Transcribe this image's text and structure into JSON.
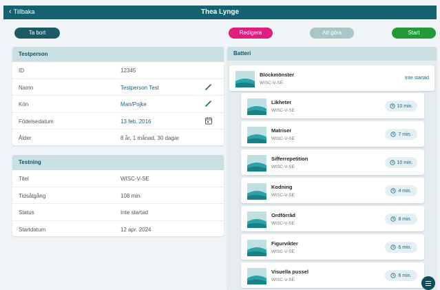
{
  "header": {
    "back_label": "Tillbaka",
    "title": "Thea Lynge"
  },
  "actions": {
    "delete": "Ta bort",
    "edit": "Redigera",
    "todo": "Att göra",
    "start": "Start"
  },
  "testperson": {
    "heading": "Testperson",
    "rows": [
      {
        "label": "ID",
        "value": "12345"
      },
      {
        "label": "Namn",
        "value": "Testperson Test"
      },
      {
        "label": "Kön",
        "value": "Man/Pojke"
      },
      {
        "label": "Födelsedatum",
        "value": "13 feb. 2016"
      },
      {
        "label": "Ålder",
        "value": "8 år, 1 månad, 30 dagar"
      }
    ]
  },
  "testning": {
    "heading": "Testning",
    "rows": [
      {
        "label": "Titel",
        "value": "WISC-V-SE"
      },
      {
        "label": "Tidsåtgång",
        "value": "108 min."
      },
      {
        "label": "Status",
        "value": "Inte startad"
      },
      {
        "label": "Startdatum",
        "value": "12 apr. 2024"
      }
    ]
  },
  "battery": {
    "heading": "Batteri",
    "main": {
      "name": "Blockmönster",
      "sub": "WISC-V-SE",
      "status": "Inte startad"
    },
    "items": [
      {
        "name": "Likheter",
        "sub": "WISC-V-SE",
        "duration": "10 min."
      },
      {
        "name": "Matriser",
        "sub": "WISC-V-SE",
        "duration": "7 min."
      },
      {
        "name": "Sifferrepetition",
        "sub": "WISC-V-SE",
        "duration": "10 min."
      },
      {
        "name": "Kodning",
        "sub": "WISC-V-SE",
        "duration": "4 min."
      },
      {
        "name": "Ordförråd",
        "sub": "WISC-V-SE",
        "duration": "8 min."
      },
      {
        "name": "Figurvikter",
        "sub": "WISC-V-SE",
        "duration": "6 min."
      },
      {
        "name": "Visuella pussel",
        "sub": "WISC-V-SE",
        "duration": "6 min."
      }
    ]
  },
  "icons": {
    "back": "chevron-left-icon",
    "edit": "pencil-icon",
    "calendar": "calendar-icon",
    "clock": "clock-icon",
    "menu": "menu-icon",
    "thumbnail": "test-thumbnail-icon"
  },
  "colors": {
    "header": "#14616f",
    "delete": "#1d5a68",
    "edit": "#e01e7f",
    "todo": "#aac5c7",
    "start": "#209a3b",
    "section_head": "#c9dfe4"
  }
}
